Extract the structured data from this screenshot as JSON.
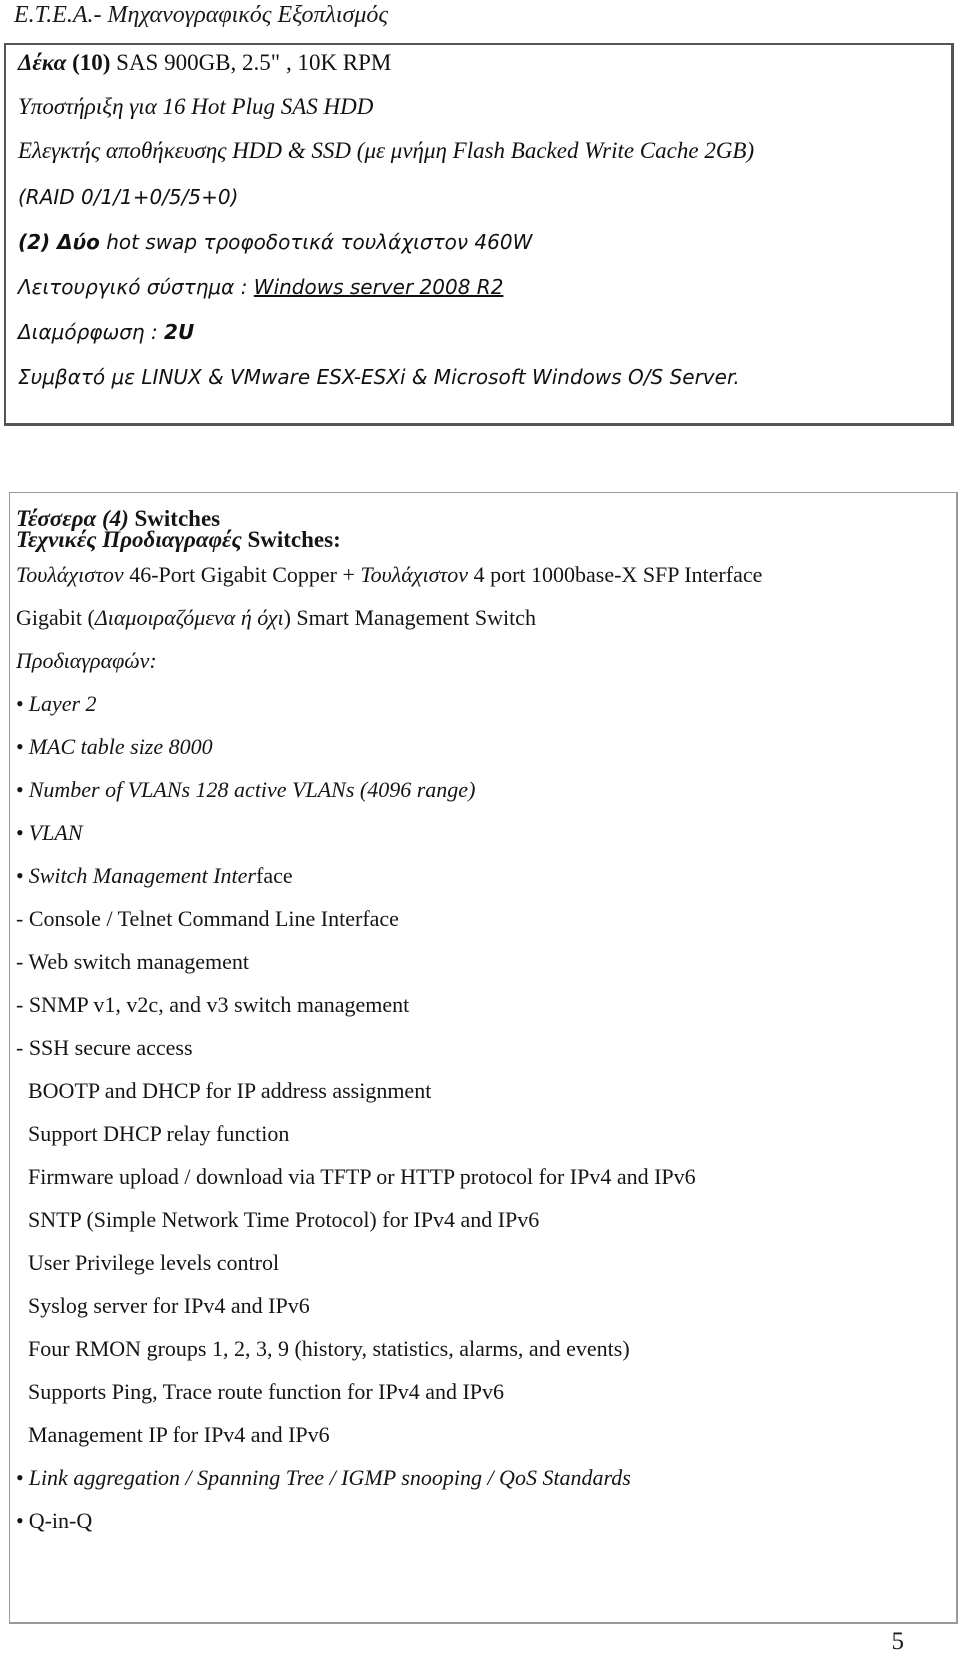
{
  "header": {
    "title": "Ε.Τ.Ε.Α.- Μηχανογραφικός Εξοπλισμός"
  },
  "server_box": {
    "disks": {
      "count_word": "Δέκα",
      "count": "(10)",
      "spec": " SAS 900GB, 2.5\" , 10K RPM"
    },
    "hot_plug": " Υποστήριξη για 16 Hot Plug SAS HDD",
    "controller": "Ελεγκτής αποθήκευσης HDD & SSD (με μνήμη Flash Backed Write Cache 2GB)",
    "raid": "(RAID 0/1/1+0/5/5+0)",
    "psu": {
      "count": "(2) Δύο",
      "spec": " hot swap τροφοδοτικά τουλάχιστον 460W"
    },
    "os": {
      "label": "Λειτουργικό σύστημα : ",
      "value": "Windows server 2008 R2"
    },
    "form_factor": {
      "label": "Διαμόρφωση : ",
      "value": "2U"
    },
    "compatibility": "Συμβατό με LINUX & VMware ESX-ESXi & Microsoft Windows O/S Server."
  },
  "switch_box": {
    "title": {
      "count_word": "Τέσσερα (4)",
      "label": " Switches"
    },
    "subtitle": {
      "label": "Τεχνικές Προδιαγραφές",
      "suffix": " Switches:"
    },
    "ports": {
      "prefix_1": "Τουλάχιστον",
      "text_1": " 46-Port Gigabit Copper + ",
      "prefix_2": "Τουλάχιστον",
      "text_2": " 4 port 1000base-X SFP Interface"
    },
    "smart": {
      "pre": "Gigabit (",
      "italic": "Διαμοιραζόμενα ή όχι",
      "post": ") Smart Management Switch"
    },
    "specs_label": "Προδιαγραφών:",
    "bullets_top": [
      "Layer 2",
      "MAC table size 8000",
      "Number of VLANs 128 active VLANs (4096 range)",
      "VLAN"
    ],
    "mgmt_interface": {
      "italic": "Switch Management Inter",
      "normal": "face"
    },
    "dash_items": [
      "- Console / Telnet Command Line Interface",
      "- Web switch management",
      "- SNMP v1, v2c, and v3 switch management",
      "- SSH secure access"
    ],
    "indented_items": [
      "BOOTP and DHCP for IP address assignment",
      "Support DHCP relay function",
      "Firmware upload / download via TFTP or HTTP protocol for IPv4 and IPv6",
      "SNTP (Simple Network Time Protocol) for IPv4 and IPv6",
      "User Privilege levels control",
      "Syslog server for IPv4 and IPv6",
      "Four RMON groups 1, 2, 3, 9 (history, statistics, alarms, and events)",
      "Supports Ping, Trace route function for IPv4 and IPv6",
      "Management IP for IPv4 and IPv6"
    ],
    "bullets_bottom": [
      "Link aggregation / Spanning Tree / IGMP snooping / QoS Standards",
      "Q-in-Q"
    ],
    "bullet_glyph": "•"
  },
  "footer": {
    "page_number": "5"
  }
}
